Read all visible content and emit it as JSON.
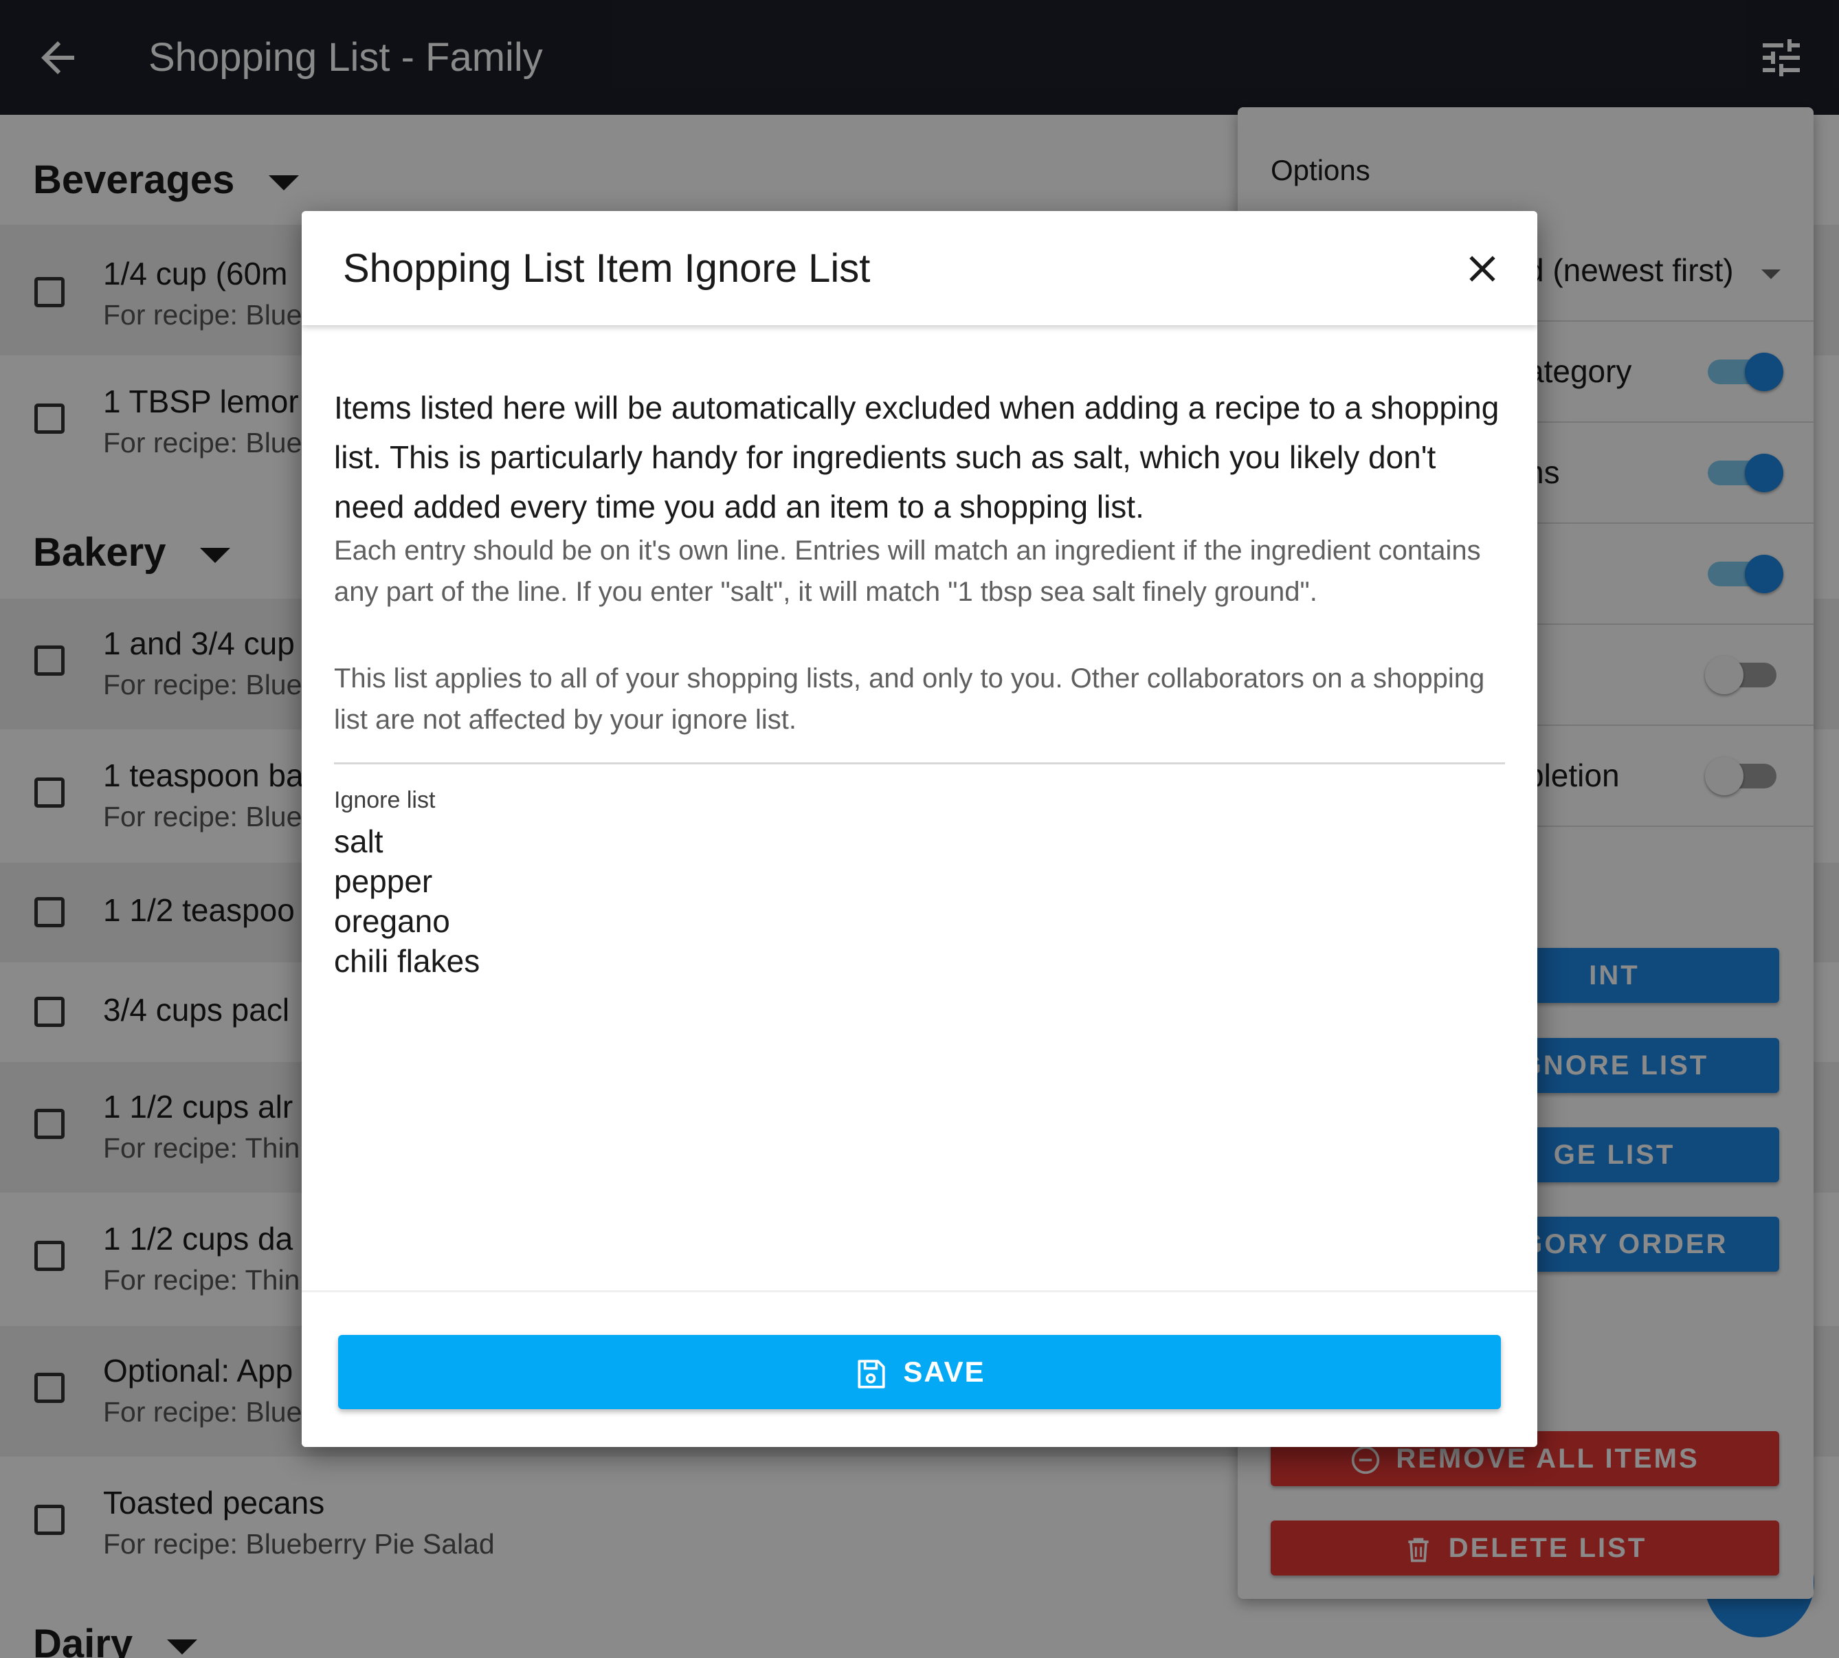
{
  "appbar": {
    "title": "Shopping List - Family",
    "back_icon": "arrow-left-icon",
    "menu_icon": "tune-icon"
  },
  "sections": [
    {
      "name": "Beverages"
    },
    {
      "name": "Bakery"
    },
    {
      "name": "Dairy"
    }
  ],
  "items": [
    {
      "name": "1/4 cup (60m",
      "recipe": "For recipe: Blue"
    },
    {
      "name": "1 TBSP lemor",
      "recipe": "For recipe: Blue"
    },
    {
      "name": "1 and 3/4 cup",
      "recipe": "For recipe: Blue"
    },
    {
      "name": "1 teaspoon ba",
      "recipe": "For recipe: Blue"
    },
    {
      "name": "1 1/2 teaspoo"
    },
    {
      "name": "3/4 cups pacl"
    },
    {
      "name": "1 1/2 cups alr",
      "recipe": "For recipe: Thin"
    },
    {
      "name": "1 1/2 cups da",
      "recipe": "For recipe: Thin"
    },
    {
      "name": "Optional: App",
      "recipe": "For recipe: Blue"
    },
    {
      "name": "Toasted pecans",
      "recipe": "For recipe: Blueberry Pie Salad"
    }
  ],
  "options": {
    "title": "Options",
    "sort_value": "d (newest first)",
    "toggles": [
      {
        "label": "ategory",
        "state": "on"
      },
      {
        "label": "ns",
        "state": "on"
      },
      {
        "label": "",
        "state": "on"
      },
      {
        "label": "",
        "state": "off"
      },
      {
        "label": "pletion",
        "state": "off"
      }
    ],
    "buttons": {
      "print": "INT",
      "ignore_list": "GNORE LIST",
      "merge_list": "GE LIST",
      "category_order": "EGORY ORDER",
      "remove_all": "REMOVE ALL ITEMS",
      "delete_list": "DELETE LIST"
    }
  },
  "dialog": {
    "title": "Shopping List Item Ignore List",
    "intro": "Items listed here will be automatically excluded when adding a recipe to a shopping list. This is particularly handy for ingredients such as salt, which you likely don't need added every time you add an item to a shopping list.",
    "help1": "Each entry should be on it's own line. Entries will match an ingredient if the ingredient contains any part of the line. If you enter \"salt\", it will match \"1 tbsp sea salt finely ground\".",
    "help2": "This list applies to all of your shopping lists, and only to you. Other collaborators on a shopping list are not affected by your ignore list.",
    "field_label": "Ignore list",
    "ignore_value": "salt\npepper\noregano\nchili flakes",
    "save_label": "SAVE"
  },
  "colors": {
    "appbar": "#1b1f2a",
    "primary": "#1e88e5",
    "save": "#03a9f4",
    "danger": "#e53935"
  }
}
